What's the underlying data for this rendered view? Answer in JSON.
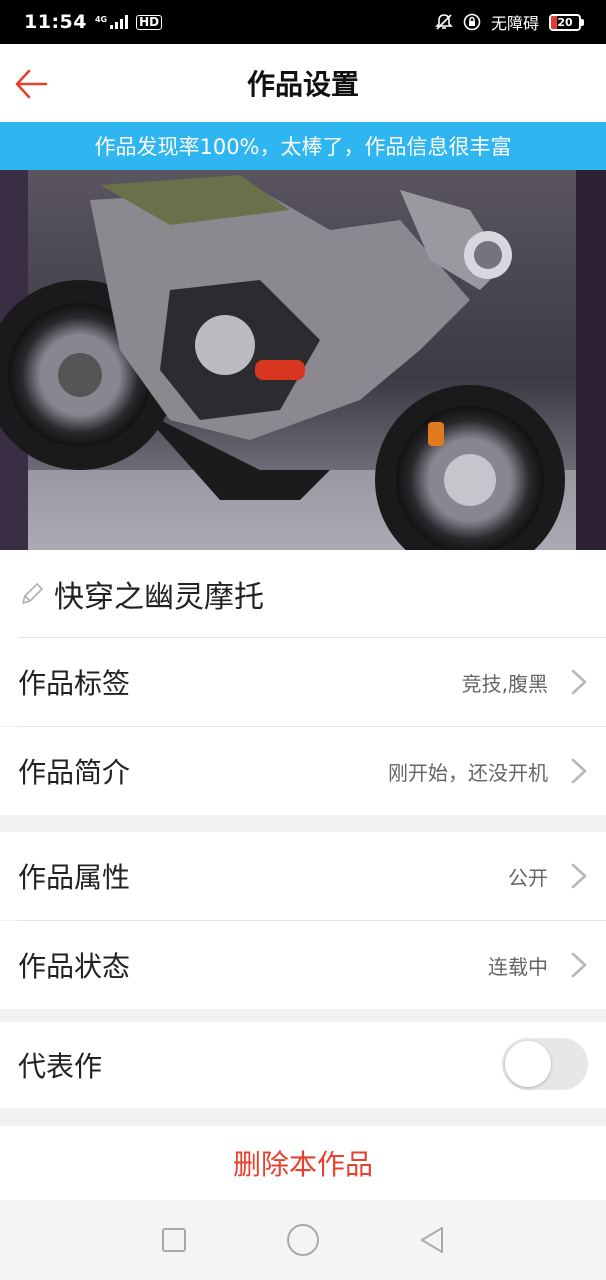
{
  "status_bar": {
    "time": "11:54",
    "network": "4G",
    "hd": "HD",
    "accessibility": "无障碍",
    "battery": "20",
    "battery_level": 0.2
  },
  "header": {
    "title": "作品设置"
  },
  "banner": {
    "text": "作品发现率100%，太棒了，作品信息很丰富"
  },
  "work": {
    "title": "快穿之幽灵摩托"
  },
  "settings": {
    "tags": {
      "label": "作品标签",
      "value": "竞技,腹黑"
    },
    "intro": {
      "label": "作品简介",
      "value": "刚开始，还没开机"
    },
    "attribute": {
      "label": "作品属性",
      "value": "公开"
    },
    "status": {
      "label": "作品状态",
      "value": "连载中"
    },
    "representative": {
      "label": "代表作",
      "enabled": false
    }
  },
  "actions": {
    "delete": "删除本作品"
  },
  "colors": {
    "accent_red": "#e8402f",
    "banner_blue": "#2fb6f0"
  }
}
